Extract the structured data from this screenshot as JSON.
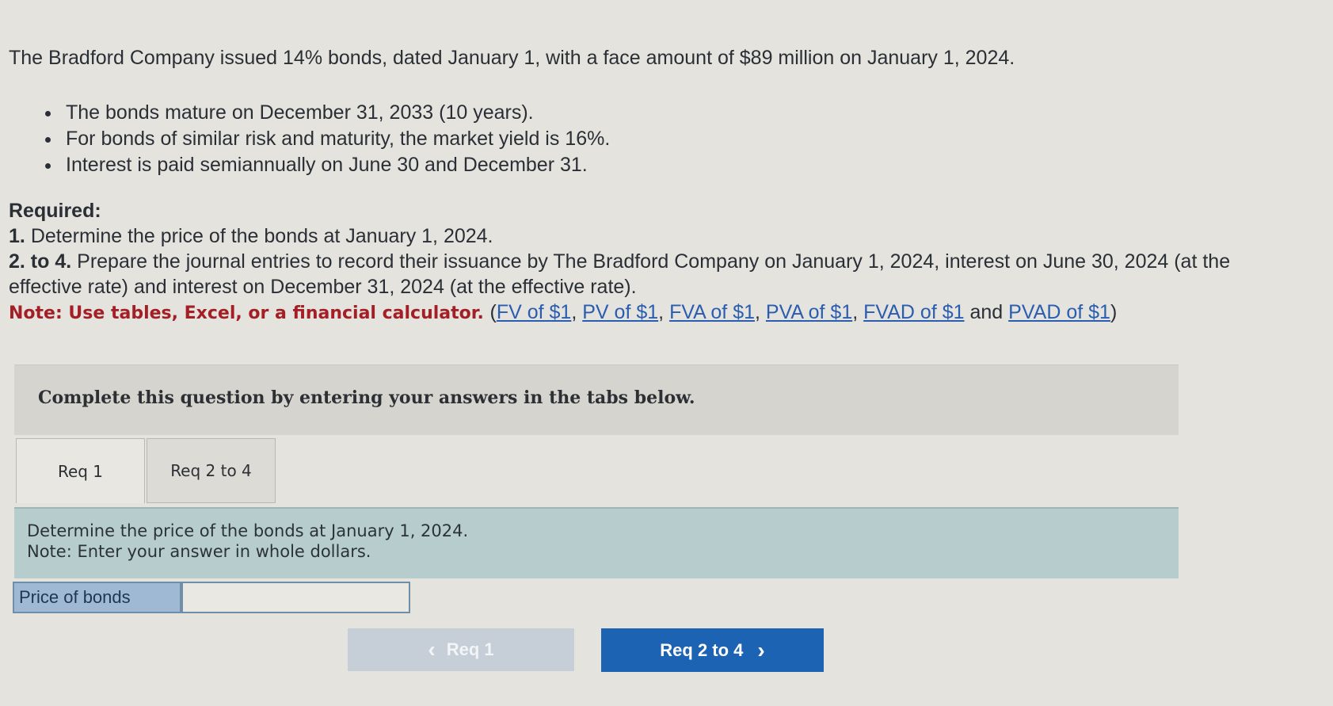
{
  "problem": {
    "intro": "The Bradford Company issued 14% bonds, dated January 1, with a face amount of $89 million on January 1, 2024.",
    "bullets": [
      "The bonds mature on December 31, 2033 (10 years).",
      "For bonds of similar risk and maturity, the market yield is 16%.",
      "Interest is paid semiannually on June 30 and December 31."
    ],
    "required_heading": "Required:",
    "req1_num": "1.",
    "req1_text": "Determine the price of the bonds at January 1, 2024.",
    "req2_num": "2. to 4.",
    "req2_text": "Prepare the journal entries to record their issuance by The Bradford Company on January 1, 2024, interest on June 30, 2024 (at the effective rate) and interest on December 31, 2024 (at the effective rate).",
    "note_label": "Note: Use tables, Excel, or a financial calculator.",
    "links": [
      "FV of $1",
      "PV of $1",
      "FVA of $1",
      "PVA of $1",
      "FVAD of $1",
      "PVAD of $1"
    ],
    "and_word": "and"
  },
  "banner": {
    "text": "Complete this question by entering your answers in the tabs below."
  },
  "tabs": [
    {
      "label": "Req 1"
    },
    {
      "label": "Req 2 to 4"
    }
  ],
  "instructions": {
    "line1": "Determine the price of the bonds at January 1, 2024.",
    "line2": "Note: Enter your answer in whole dollars."
  },
  "answer": {
    "label": "Price of bonds",
    "value": ""
  },
  "nav": {
    "prev_label": "Req 1",
    "next_label": "Req 2 to 4"
  },
  "colors": {
    "note_red": "#a31f25",
    "link_blue": "#2a5db0",
    "next_button": "#1d63b3",
    "instruction_bg": "#b7cdcd"
  }
}
